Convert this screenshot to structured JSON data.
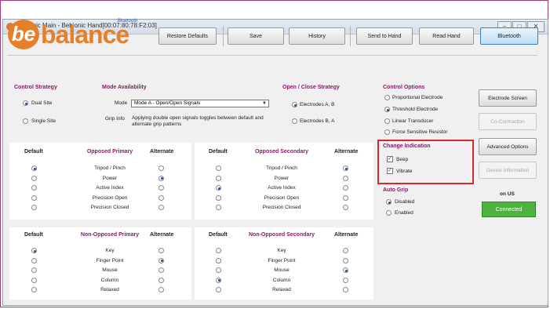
{
  "window": {
    "title": "bebionic Main - Bebionic Hand[00:07:80:78:F2:03]",
    "controls": [
      "–",
      "□",
      "✕"
    ]
  },
  "logo": {
    "be": "be",
    "text": "balance",
    "badge": "Bluetooth"
  },
  "toolbar": {
    "restore_defaults": "Restore Defaults",
    "save": "Save",
    "history": "History",
    "send_to_hand": "Send to Hand",
    "read_hand": "Read Hand",
    "bluetooth": "Bluetooth"
  },
  "control_strategy": {
    "title": "Control Strategy",
    "options": [
      {
        "label": "Dual Site",
        "selected": true
      },
      {
        "label": "Single Site",
        "selected": false
      }
    ]
  },
  "mode_availability": {
    "title": "Mode Availability",
    "mode_label": "Mode",
    "mode_value": "Mode A - Open/Open Signals",
    "grip_info_label": "Grip Info",
    "grip_info_text": "Applying double open signals toggles between default and alternate grip patterns"
  },
  "open_close_strategy": {
    "title": "Open / Close Strategy",
    "options": [
      {
        "label": "Electrodes A, B",
        "selected": true
      },
      {
        "label": "Electrodes B, A",
        "selected": false
      }
    ]
  },
  "control_options": {
    "title": "Control Options",
    "options": [
      {
        "label": "Proportional Electrode",
        "selected": false
      },
      {
        "label": "Threshold Electrode",
        "selected": true
      },
      {
        "label": "Linear Transducer",
        "selected": false
      },
      {
        "label": "Force Sensitive Resistor",
        "selected": false
      }
    ]
  },
  "change_indication": {
    "title": "Change Indication",
    "options": [
      {
        "label": "Beep",
        "checked": true
      },
      {
        "label": "Vibrate",
        "checked": true
      }
    ]
  },
  "auto_grip": {
    "title": "Auto Grip",
    "options": [
      {
        "label": "Disabled",
        "selected": true
      },
      {
        "label": "Enabled",
        "selected": false
      }
    ]
  },
  "side_buttons": {
    "electrode_screen": "Electrode Screen",
    "co_contraction": "Co-Contraction",
    "advanced_options": "Advanced Options",
    "device_information": "Device Information"
  },
  "connection": {
    "label": "on US",
    "status": "Connected"
  },
  "grip_tables": [
    {
      "title": "Opposed Primary",
      "default_header": "Default",
      "alternate_header": "Alternate",
      "rows": [
        {
          "label": "Tripod / Pinch",
          "default": true,
          "alternate": false
        },
        {
          "label": "Power",
          "default": false,
          "alternate": true
        },
        {
          "label": "Active Index",
          "default": false,
          "alternate": false
        },
        {
          "label": "Precision Open",
          "default": false,
          "alternate": false
        },
        {
          "label": "Precision Closed",
          "default": false,
          "alternate": false
        }
      ]
    },
    {
      "title": "Opposed Secondary",
      "default_header": "Default",
      "alternate_header": "Alternate",
      "rows": [
        {
          "label": "Tripod / Pinch",
          "default": false,
          "alternate": true
        },
        {
          "label": "Power",
          "default": false,
          "alternate": false
        },
        {
          "label": "Active Index",
          "default": true,
          "alternate": false
        },
        {
          "label": "Precision Open",
          "default": false,
          "alternate": false
        },
        {
          "label": "Precision Closed",
          "default": false,
          "alternate": false
        }
      ]
    },
    {
      "title": "Non-Opposed Primary",
      "default_header": "Default",
      "alternate_header": "Alternate",
      "rows": [
        {
          "label": "Key",
          "default": true,
          "alternate": false
        },
        {
          "label": "Finger Point",
          "default": false,
          "alternate": true
        },
        {
          "label": "Mouse",
          "default": false,
          "alternate": false
        },
        {
          "label": "Column",
          "default": false,
          "alternate": false
        },
        {
          "label": "Relaxed",
          "default": false,
          "alternate": false
        }
      ]
    },
    {
      "title": "Non-Opposed Secondary",
      "default_header": "Default",
      "alternate_header": "Alternate",
      "rows": [
        {
          "label": "Key",
          "default": false,
          "alternate": false
        },
        {
          "label": "Finger Point",
          "default": false,
          "alternate": false
        },
        {
          "label": "Mouse",
          "default": false,
          "alternate": true
        },
        {
          "label": "Column",
          "default": true,
          "alternate": false
        },
        {
          "label": "Relaxed",
          "default": false,
          "alternate": false
        }
      ]
    }
  ],
  "colors": {
    "accent": "#e57f2a",
    "header": "#8b1a6b",
    "highlight": "#d6282f",
    "connected": "#4db240"
  }
}
